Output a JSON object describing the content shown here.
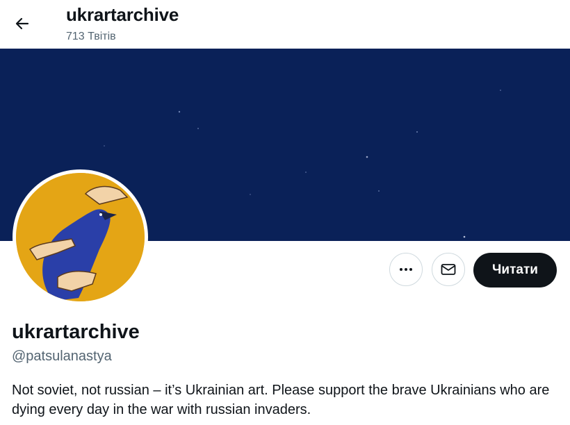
{
  "header": {
    "title": "ukrartarchive",
    "tweet_count": "713 Твітів",
    "back_icon": "arrow-left-icon"
  },
  "banner": {
    "color": "#0a2158"
  },
  "actions": {
    "more_icon": "more-dots-icon",
    "message_icon": "envelope-icon",
    "follow_label": "Читати"
  },
  "profile": {
    "display_name": "ukrartarchive",
    "handle": "@patsulanastya",
    "bio": "Not soviet, not russian – it’s Ukrainian art. Please support the brave Ukrainians who are dying every day in the war with russian invaders."
  },
  "colors": {
    "text": "#0f1419",
    "secondary_text": "#536471",
    "border": "#cfd9de",
    "avatar_bg": "#e8a916",
    "bird": "#2a3fa8"
  }
}
